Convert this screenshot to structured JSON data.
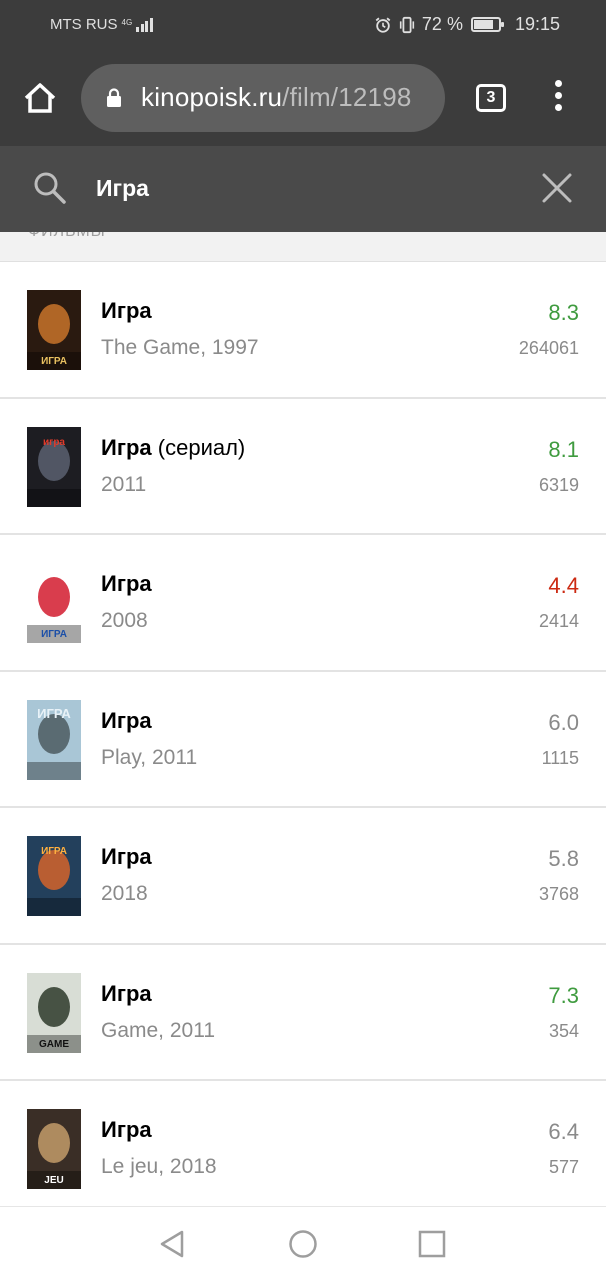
{
  "status_bar": {
    "carrier": "MTS RUS",
    "network": "4G",
    "battery_percent": "72 %",
    "time": "19:15",
    "battery_level": 0.72,
    "icons": [
      "signal-icon",
      "alarm-icon",
      "vibrate-icon",
      "battery-icon"
    ]
  },
  "browser": {
    "url_domain": "kinopoisk.ru",
    "url_path": "/film/12198",
    "tabs_count": "3",
    "icons": [
      "home-icon",
      "lock-icon",
      "tabs-icon",
      "more-menu-icon"
    ]
  },
  "search": {
    "query": "Игра",
    "icons": [
      "search-icon",
      "close-icon"
    ]
  },
  "section": {
    "header": "ФИЛЬМЫ"
  },
  "results": [
    {
      "title": "Игра",
      "title_suffix": "",
      "subtitle": "The Game, 1997",
      "rating": "8.3",
      "votes": "264061",
      "rating_color": "#3f9b3f"
    },
    {
      "title": "Игра",
      "title_suffix": " (сериал)",
      "subtitle": "2011",
      "rating": "8.1",
      "votes": "6319",
      "rating_color": "#3f9b3f"
    },
    {
      "title": "Игра",
      "title_suffix": "",
      "subtitle": "2008",
      "rating": "4.4",
      "votes": "2414",
      "rating_color": "#cc2a12"
    },
    {
      "title": "Игра",
      "title_suffix": "",
      "subtitle": "Play, 2011",
      "rating": "6.0",
      "votes": "1115",
      "rating_color": "#8a8a8a"
    },
    {
      "title": "Игра",
      "title_suffix": "",
      "subtitle": "2018",
      "rating": "5.8",
      "votes": "3768",
      "rating_color": "#8a8a8a"
    },
    {
      "title": "Игра",
      "title_suffix": "",
      "subtitle": "Game, 2011",
      "rating": "7.3",
      "votes": "354",
      "rating_color": "#3f9b3f"
    },
    {
      "title": "Игра",
      "title_suffix": "",
      "subtitle": "Le jeu, 2018",
      "rating": "6.4",
      "votes": "577",
      "rating_color": "#8a8a8a"
    }
  ],
  "posters": [
    {
      "text": "ИГРА",
      "bg": "#2a1a10",
      "accent": "#c8742a",
      "text_color": "#e8c060"
    },
    {
      "text": "игра",
      "bg": "#1d1d22",
      "accent": "#5a6070",
      "text_color": "#e23a2a"
    },
    {
      "text": "ИГРА",
      "bg": "#ffffff",
      "accent": "#d21b2e",
      "text_color": "#1b4fa8"
    },
    {
      "text": "ИГРА",
      "bg": "#a9c6d6",
      "accent": "#4c5a60",
      "text_color": "#e8f2f8"
    },
    {
      "text": "ИГРА",
      "bg": "#23405c",
      "accent": "#d3642a",
      "text_color": "#ffb040"
    },
    {
      "text": "GAME",
      "bg": "#d8ddd5",
      "accent": "#2e3a2a",
      "text_color": "#111111"
    },
    {
      "text": "JEU",
      "bg": "#3a2e26",
      "accent": "#c39b6a",
      "text_color": "#ffffff"
    }
  ],
  "nav_bar": {
    "icons": [
      "back-icon",
      "home-circle-icon",
      "recents-icon"
    ]
  }
}
